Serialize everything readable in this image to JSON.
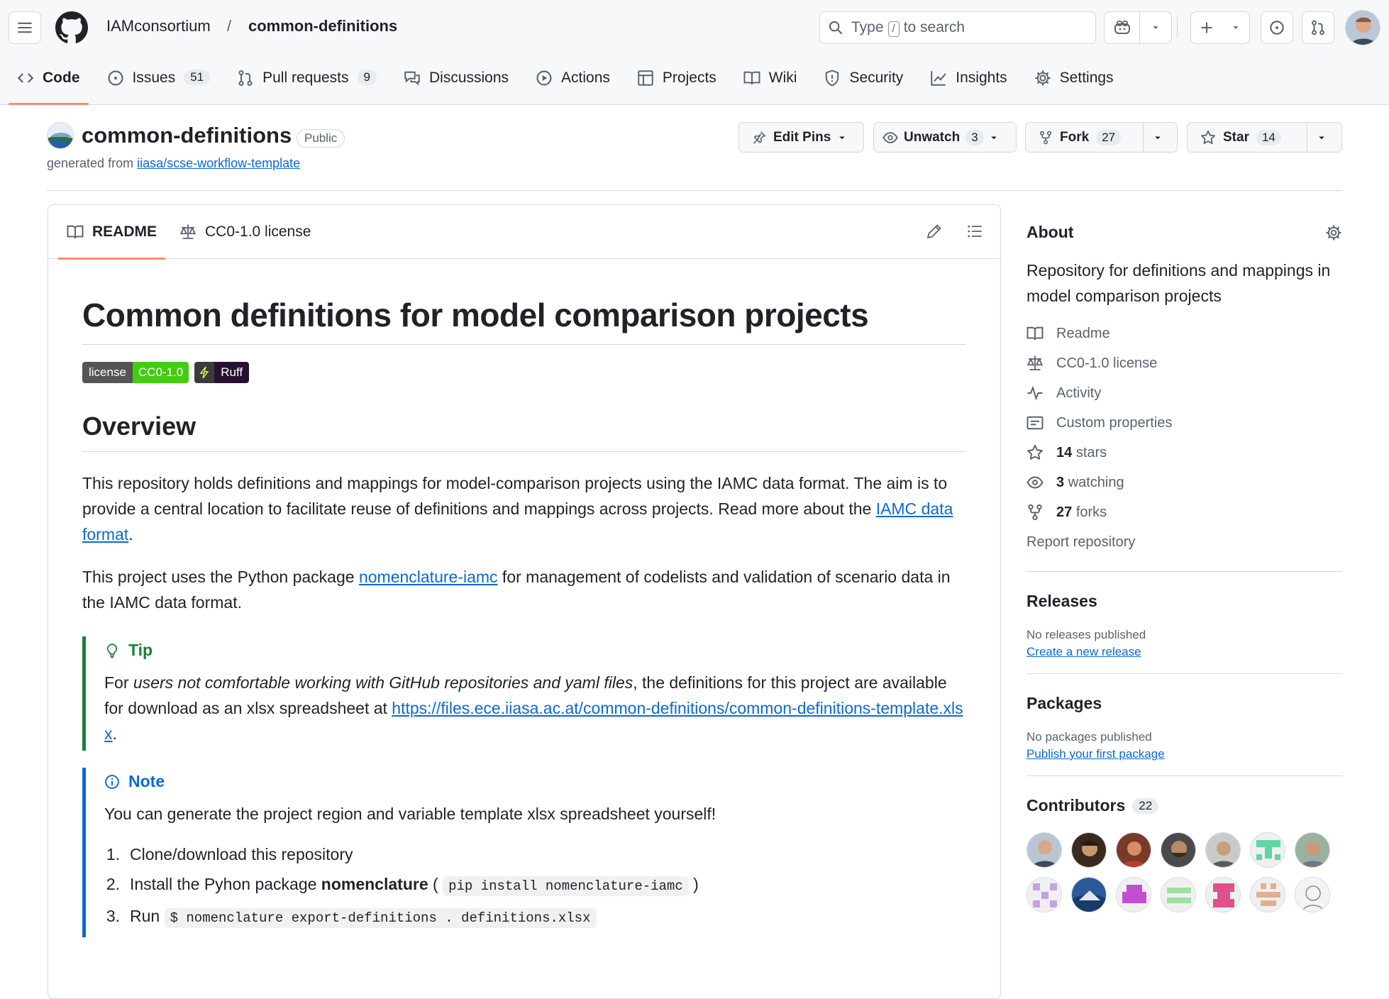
{
  "header": {
    "owner": "IAMconsortium",
    "sep": "/",
    "repo": "common-definitions",
    "search_type": "Type",
    "search_key": "/",
    "search_rest": "to search"
  },
  "tabs": [
    {
      "label": "Code"
    },
    {
      "label": "Issues",
      "count": "51"
    },
    {
      "label": "Pull requests",
      "count": "9"
    },
    {
      "label": "Discussions"
    },
    {
      "label": "Actions"
    },
    {
      "label": "Projects"
    },
    {
      "label": "Wiki"
    },
    {
      "label": "Security"
    },
    {
      "label": "Insights"
    },
    {
      "label": "Settings"
    }
  ],
  "repo": {
    "name": "common-definitions",
    "visibility": "Public",
    "generated_prefix": "generated from",
    "generated_link": "iiasa/scse-workflow-template"
  },
  "actions": {
    "edit_pins": "Edit Pins",
    "unwatch": "Unwatch",
    "watch_count": "3",
    "fork": "Fork",
    "fork_count": "27",
    "star": "Star",
    "star_count": "14"
  },
  "readme_tabs": {
    "readme": "README",
    "license": "CC0-1.0 license"
  },
  "readme": {
    "title": "Common definitions for model comparison projects",
    "badge_license_l": "license",
    "badge_license_r": "CC0-1.0",
    "badge_ruff": "Ruff",
    "overview": "Overview",
    "p1_a": "This repository holds definitions and mappings for model-comparison projects using the IAMC data format. The aim is to provide a central location to facilitate reuse of definitions and mappings across projects. Read more about the ",
    "p1_link": "IAMC data format",
    "p1_end": ".",
    "p2_a": "This project uses the Python package ",
    "p2_link": "nomenclature-iamc",
    "p2_b": " for management of codelists and validation of scenario data in the IAMC data format.",
    "tip_title": "Tip",
    "tip_a": "For ",
    "tip_em": "users not comfortable working with GitHub repositories and yaml files",
    "tip_b": ", the definitions for this project are available for download as an xlsx spreadsheet at ",
    "tip_link": "https://files.ece.iiasa.ac.at/common-definitions/common-definitions-template.xlsx",
    "tip_end": ".",
    "note_title": "Note",
    "note_text": "You can generate the project region and variable template xlsx spreadsheet yourself!",
    "steps": [
      {
        "n": "1.",
        "text": "Clone/download this repository"
      },
      {
        "n": "2.",
        "a": "Install the Pyhon package ",
        "b": "nomenclature",
        "c": " ( ",
        "code": "pip install nomenclature-iamc",
        "d": " )"
      },
      {
        "n": "3.",
        "a": "Run ",
        "code": "$ nomenclature export-definitions . definitions.xlsx"
      }
    ]
  },
  "about": {
    "title": "About",
    "desc": "Repository for definitions and mappings in model comparison projects",
    "readme": "Readme",
    "license": "CC0-1.0 license",
    "activity": "Activity",
    "custom": "Custom properties",
    "stars_n": "14",
    "stars": "stars",
    "watching_n": "3",
    "watching": "watching",
    "forks_n": "27",
    "forks": "forks",
    "report": "Report repository"
  },
  "releases": {
    "title": "Releases",
    "none": "No releases published",
    "link": "Create a new release"
  },
  "packages": {
    "title": "Packages",
    "none": "No packages published",
    "link": "Publish your first package"
  },
  "contributors": {
    "title": "Contributors",
    "count": "22"
  },
  "colors": {
    "accent": "#fd8c73",
    "link": "#0969da",
    "tip": "#1a7f37",
    "note": "#0969da"
  }
}
